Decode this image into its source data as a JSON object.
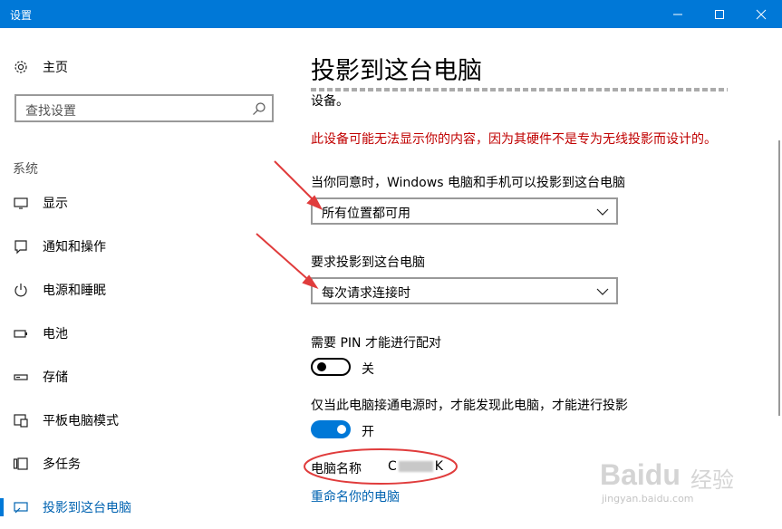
{
  "window": {
    "title": "设置",
    "minimize_icon": "minimize-icon",
    "maximize_icon": "maximize-icon",
    "close_icon": "close-icon",
    "accent": "#0078d7"
  },
  "sidebar": {
    "home": {
      "label": "主页",
      "icon": "gear-icon"
    },
    "search": {
      "placeholder": "查找设置",
      "icon": "search-icon"
    },
    "section_title": "系统",
    "items": [
      {
        "label": "显示",
        "icon": "monitor-icon"
      },
      {
        "label": "通知和操作",
        "icon": "notification-icon"
      },
      {
        "label": "电源和睡眠",
        "icon": "power-icon"
      },
      {
        "label": "电池",
        "icon": "battery-icon"
      },
      {
        "label": "存储",
        "icon": "storage-icon"
      },
      {
        "label": "平板电脑模式",
        "icon": "tablet-mode-icon"
      },
      {
        "label": "多任务",
        "icon": "multitask-icon"
      },
      {
        "label": "投影到这台电脑",
        "icon": "project-icon",
        "active": true
      }
    ]
  },
  "main": {
    "title": "投影到这台电脑",
    "desc_end": "设备。",
    "warning": "此设备可能无法显示你的内容，因为其硬件不是专为无线投影而设计的。",
    "warning_color": "#c00000",
    "availability": {
      "label": "当你同意时，Windows 电脑和手机可以投影到这台电脑",
      "value": "所有位置都可用"
    },
    "ask": {
      "label": "要求投影到这台电脑",
      "value": "每次请求连接时"
    },
    "pin": {
      "label": "需要 PIN 才能进行配对",
      "state": "关",
      "on": false
    },
    "power": {
      "label": "仅当此电脑接通电源时，才能发现此电脑，才能进行投影",
      "state": "开",
      "on": true
    },
    "pc_name": {
      "label": "电脑名称",
      "prefix": "C",
      "suffix": "K"
    },
    "rename_link": "重命名你的电脑"
  },
  "watermark": {
    "brand": "Baidu",
    "sub": "经验",
    "url": "jingyan.baidu.com"
  },
  "annotation_color": "#e03c3c"
}
